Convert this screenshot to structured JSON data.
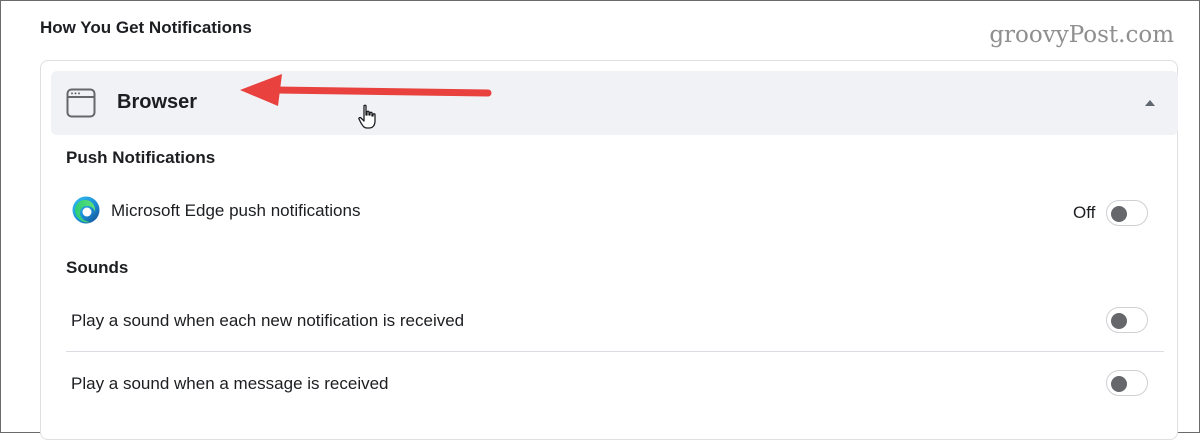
{
  "section": {
    "title": "How You Get Notifications"
  },
  "watermark": "groovyPost.com",
  "browser": {
    "label": "Browser",
    "icon": "browser-window-icon",
    "expand_icon": "triangle-up-icon"
  },
  "push": {
    "title": "Push Notifications",
    "edge": {
      "icon": "microsoft-edge-icon",
      "label": "Microsoft Edge push notifications",
      "state_label": "Off",
      "enabled": false
    }
  },
  "sounds": {
    "title": "Sounds",
    "items": [
      {
        "label": "Play a sound when each new notification is received",
        "enabled": false
      },
      {
        "label": "Play a sound when a message is received",
        "enabled": false
      }
    ]
  },
  "colors": {
    "arrow": "#e8413e",
    "header_bg": "#f0f2f5",
    "toggle_knob": "#65676b"
  }
}
